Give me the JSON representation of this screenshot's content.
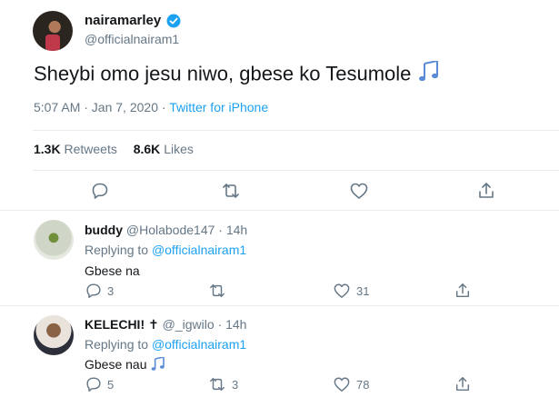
{
  "main_tweet": {
    "display_name": "nairamarley",
    "handle": "@officialnairam1",
    "verified": true,
    "text": "Sheybi omo jesu niwo, gbese ko Tesumole",
    "text_icon": "musical-notes-icon",
    "date": "5:07 AM · Jan 7, 2020",
    "source": "Twitter for iPhone",
    "retweets": {
      "count": "1.3K",
      "label": "Retweets"
    },
    "likes": {
      "count": "8.6K",
      "label": "Likes"
    }
  },
  "replies": [
    {
      "display_name": "buddy",
      "handle": "@Holabode147",
      "time": "14h",
      "replying_label": "Replying to",
      "replying_to": "@officialnairam1",
      "text": "Gbese na",
      "reply_count": "3",
      "retweet_count": "",
      "like_count": "31"
    },
    {
      "display_name": "KELECHI! ✝",
      "handle": "@_igwilo",
      "time": "14h",
      "replying_label": "Replying to",
      "replying_to": "@officialnairam1",
      "text": "Gbese nau",
      "text_icon": "musical-notes-icon",
      "reply_count": "5",
      "retweet_count": "3",
      "like_count": "78"
    }
  ],
  "colors": {
    "accent": "#1da1f2",
    "muted": "#657786",
    "divider": "#e6ecf0",
    "text": "#14171a"
  }
}
